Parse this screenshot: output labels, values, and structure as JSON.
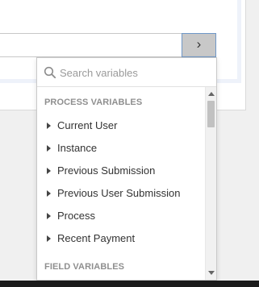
{
  "variable_picker": {
    "toggle_button_label": "›",
    "search": {
      "placeholder": "Search variables",
      "value": ""
    },
    "sections": [
      {
        "label": "PROCESS VARIABLES",
        "items": [
          "Current User",
          "Instance",
          "Previous Submission",
          "Previous User Submission",
          "Process",
          "Recent Payment"
        ]
      },
      {
        "label": "FIELD VARIABLES",
        "items": []
      }
    ]
  },
  "icons": {
    "search": "search-icon",
    "expand_arrow": "caret-right-icon",
    "scroll_up": "scroll-up-icon",
    "scroll_down": "scroll-down-icon"
  },
  "colors": {
    "button_background": "#c8c8c8",
    "button_border": "#6f97c7",
    "section_label": "#8f8f8f",
    "item_text": "#333333"
  }
}
